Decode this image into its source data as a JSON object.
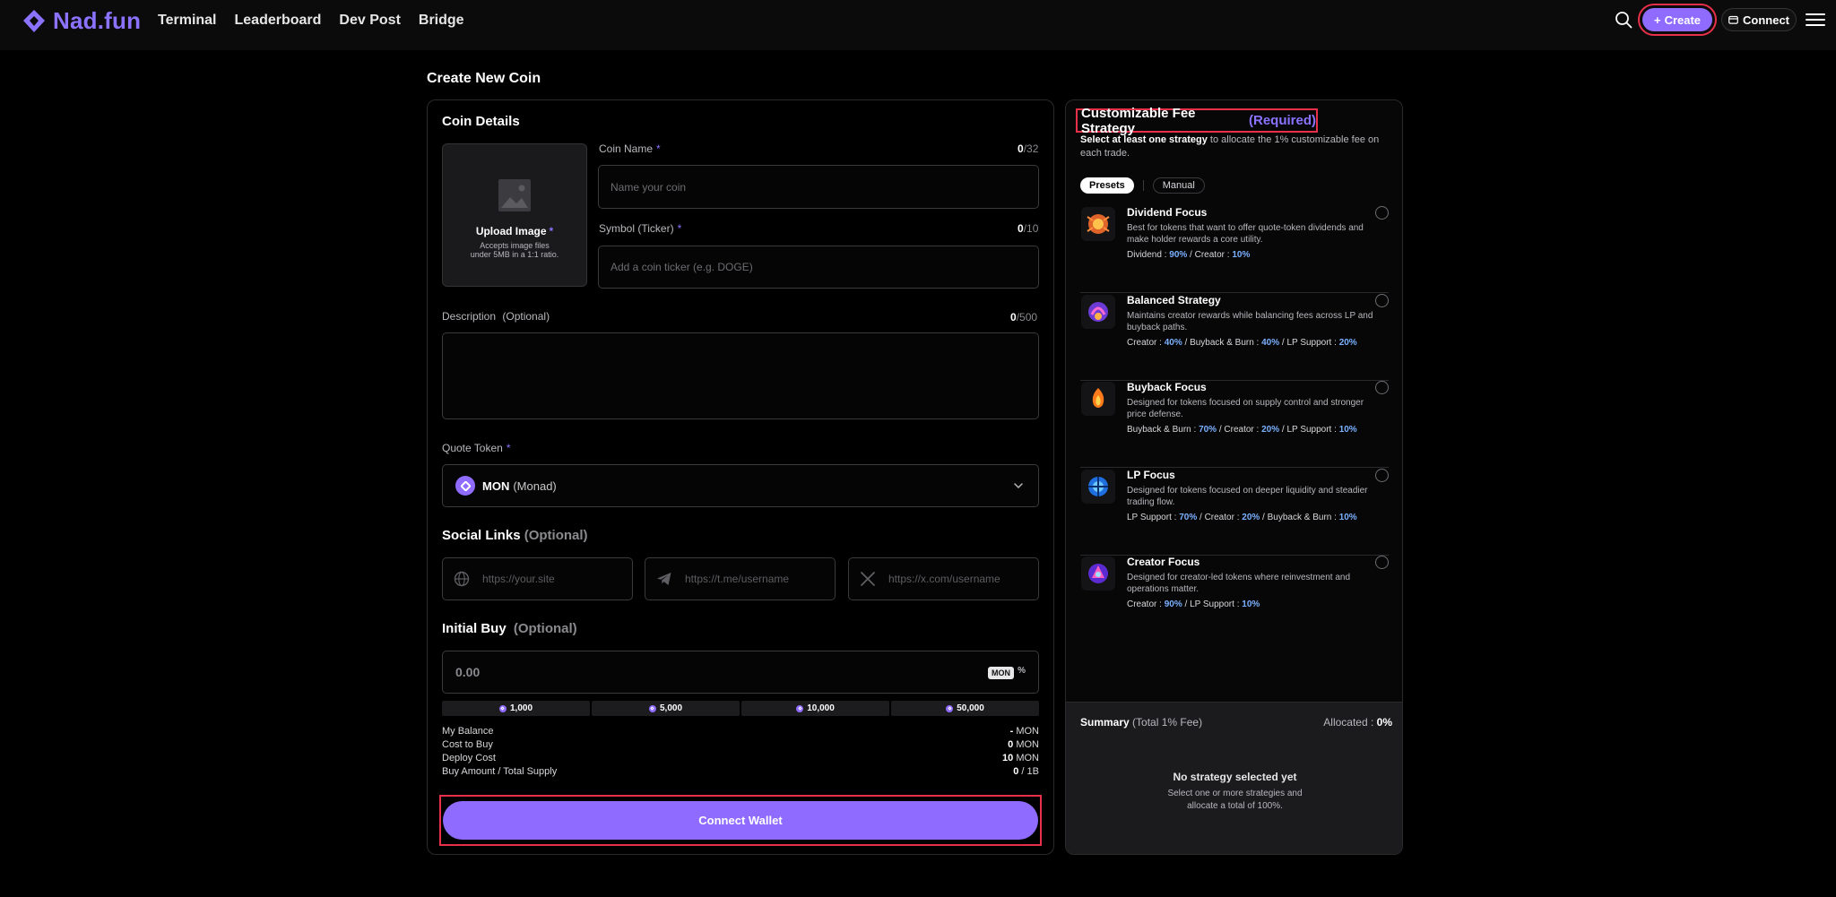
{
  "brand": {
    "name": "Nad.fun"
  },
  "nav": [
    {
      "label": "Terminal"
    },
    {
      "label": "Leaderboard"
    },
    {
      "label": "Dev Post"
    },
    {
      "label": "Bridge"
    }
  ],
  "header": {
    "create_label": "Create",
    "connect_label": "Connect"
  },
  "page": {
    "title": "Create New Coin"
  },
  "coin_details": {
    "title": "Coin Details",
    "upload": {
      "title": "Upload Image",
      "required": "*",
      "note_line1": "Accepts image files",
      "note_line2": "under 5MB in a 1:1 ratio."
    },
    "name": {
      "label": "Coin Name",
      "required": "*",
      "count": "0",
      "max": "/32",
      "placeholder": "Name your coin"
    },
    "symbol": {
      "label": "Symbol (Ticker)",
      "required": "*",
      "count": "0",
      "max": "/10",
      "placeholder": "Add a coin ticker (e.g. DOGE)"
    },
    "description": {
      "label": "Description",
      "optional": "(Optional)",
      "count": "0",
      "max": "/500"
    },
    "quote_token": {
      "label": "Quote Token",
      "required": "*",
      "symbol": "MON",
      "name": "(Monad)"
    }
  },
  "social_links": {
    "title": "Social Links",
    "optional": "(Optional)",
    "website_placeholder": "https://your.site",
    "telegram_placeholder": "https://t.me/username",
    "x_placeholder": "https://x.com/username"
  },
  "initial_buy": {
    "title": "Initial Buy",
    "optional": "(Optional)",
    "value": "0.00",
    "unit": "MON",
    "pct": "%",
    "presets": [
      "1,000",
      "5,000",
      "10,000",
      "50,000"
    ]
  },
  "stats": [
    {
      "label": "My Balance",
      "value": "-",
      "unit": " MON"
    },
    {
      "label": "Cost to Buy",
      "value": "0",
      "unit": " MON"
    },
    {
      "label": "Deploy Cost",
      "value": "10",
      "unit": " MON"
    },
    {
      "label": "Buy Amount / Total Supply",
      "value": "0",
      "unit": " / 1B"
    }
  ],
  "connect_wallet_label": "Connect Wallet",
  "fee_strategy": {
    "title": "Customizable Fee Strategy",
    "required": "(Required)",
    "subtitle_bold": "Select at least one strategy",
    "subtitle_rest": " to allocate the 1% customizable fee on each trade.",
    "tabs": [
      "Presets",
      "Manual"
    ],
    "strategies": [
      {
        "name": "Dividend Focus",
        "desc": "Best for tokens that want to offer quote-token dividends and make holder rewards a core utility.",
        "split": [
          {
            "k": "Dividend",
            "v": "90%"
          },
          {
            "k": "Creator",
            "v": "10%"
          }
        ]
      },
      {
        "name": "Balanced Strategy",
        "desc": "Maintains creator rewards while balancing fees across LP and buyback paths.",
        "split": [
          {
            "k": "Creator",
            "v": "40%"
          },
          {
            "k": "Buyback & Burn",
            "v": "40%"
          },
          {
            "k": "LP Support",
            "v": "20%"
          }
        ]
      },
      {
        "name": "Buyback Focus",
        "desc": "Designed for tokens focused on supply control and stronger price defense.",
        "split": [
          {
            "k": "Buyback & Burn",
            "v": "70%"
          },
          {
            "k": "Creator",
            "v": "20%"
          },
          {
            "k": "LP Support",
            "v": "10%"
          }
        ]
      },
      {
        "name": "LP Focus",
        "desc": "Designed for tokens focused on deeper liquidity and steadier trading flow.",
        "split": [
          {
            "k": "LP Support",
            "v": "70%"
          },
          {
            "k": "Creator",
            "v": "20%"
          },
          {
            "k": "Buyback & Burn",
            "v": "10%"
          }
        ]
      },
      {
        "name": "Creator Focus",
        "desc": "Designed for creator-led tokens where reinvestment and operations matter.",
        "split": [
          {
            "k": "Creator",
            "v": "90%"
          },
          {
            "k": "LP Support",
            "v": "10%"
          }
        ]
      }
    ],
    "summary": {
      "title": "Summary",
      "title_note": "(Total 1% Fee)",
      "alloc_label": "Allocated : ",
      "alloc_value": "0%",
      "empty_title": "No strategy selected yet",
      "empty_note": "Select one or more strategies and allocate a total of 100%."
    }
  },
  "colors": {
    "accent": "#8f6bff",
    "highlight": "#e8304a",
    "percent": "#7ab0ff"
  }
}
